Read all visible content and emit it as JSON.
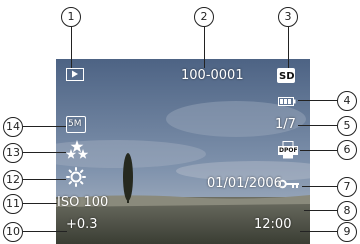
{
  "overlay": {
    "play_icon": "play-mode-icon",
    "file_number": "100-0001",
    "sd_label": "SD",
    "battery_icon": "battery-icon",
    "image_index": "1/7",
    "dpof_label": "DPOF",
    "protect_icon": "key-protect-icon",
    "date": "01/01/2006",
    "time": "12:00",
    "exposure": "+0.3",
    "iso": "ISO 100",
    "white_balance_icon": "sunny-white-balance-icon",
    "quality_icon": "quality-stars-icon",
    "resolution_label": "5M"
  },
  "callouts": [
    "1",
    "2",
    "3",
    "4",
    "5",
    "6",
    "7",
    "8",
    "9",
    "10",
    "11",
    "12",
    "13",
    "14"
  ]
}
